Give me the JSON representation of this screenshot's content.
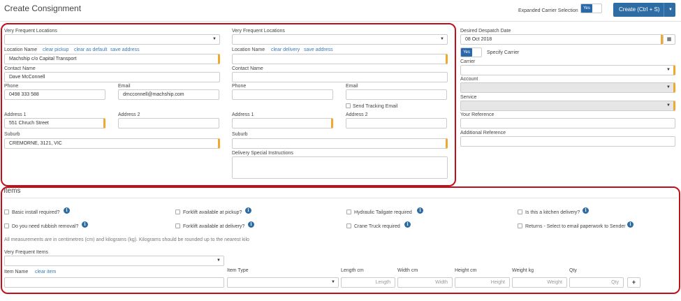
{
  "page": {
    "title": "Create Consignment"
  },
  "toolbar": {
    "expanded_carrier_label": "Expanded Carrier Selection",
    "expanded_toggle": "Yes",
    "create_label": "Create (Ctrl + S)",
    "create_dropdown_icon": "caret-down-icon"
  },
  "pickup": {
    "vfl_label": "Very Frequent Locations",
    "location_label": "Location Name",
    "clear_pickup": "clear pickup",
    "clear_default": "clear as default",
    "save_address": "save address",
    "location_value": "Machship c/o Capital Transport",
    "contact_label": "Contact Name",
    "contact_value": "Dave McConnell",
    "phone_label": "Phone",
    "phone_value": "0498 333 588",
    "email_label": "Email",
    "email_value": "dmcconnell@machship.com",
    "address1_label": "Address 1",
    "address1_value": "551 Chruch Street",
    "address2_label": "Address 2",
    "suburb_label": "Suburb",
    "suburb_value": "CREMORNE, 3121, VIC"
  },
  "delivery": {
    "vfl_label": "Very Frequent Locations",
    "location_label": "Location Name",
    "clear_delivery": "clear delivery",
    "save_address": "save address",
    "contact_label": "Contact Name",
    "phone_label": "Phone",
    "email_label": "Email",
    "send_tracking": "Send Tracking Email",
    "address1_label": "Address 1",
    "address2_label": "Address 2",
    "suburb_label": "Suburb",
    "instructions_label": "Delivery Special Instructions"
  },
  "right": {
    "despatch_label": "Desired Despatch Date",
    "despatch_value": "08 Oct 2018",
    "calendar_icon": "calendar-icon",
    "specify_toggle": "Yes",
    "specify_label": "Specify Carrier",
    "carrier_label": "Carrier",
    "account_label": "Account",
    "service_label": "Service",
    "reference_label": "Your Reference",
    "additional_label": "Additional Reference"
  },
  "items": {
    "title": "Items",
    "checks": [
      "Basic install required?",
      "Forklift available at pickup?",
      "Hydraulic Tailgate required",
      "Is this a kitchen delivery?",
      "Do you need rubbish removal?",
      "Forklift available at delivery?",
      "Crane Truck required",
      "Returns - Select to email paperwork to Sender"
    ],
    "note": "All measurements are in centimetres (cm) and kilograms (kg). Kilograms should be rounded up to the nearest kilo",
    "vfi_label": "Very Frequent Items",
    "item_name_label": "Item Name",
    "clear_item": "clear item",
    "item_type_label": "Item Type",
    "length_label": "Length cm",
    "width_label": "Width cm",
    "height_label": "Height cm",
    "weight_label": "Weight kg",
    "qty_label": "Qty",
    "length_ph": "Length",
    "width_ph": "Width",
    "height_ph": "Height",
    "weight_ph": "Weight",
    "qty_ph": "Qty",
    "add_label": "+"
  },
  "colors": {
    "accent": "#2e6da4",
    "required": "#f0a830",
    "highlight": "#c0101a"
  }
}
